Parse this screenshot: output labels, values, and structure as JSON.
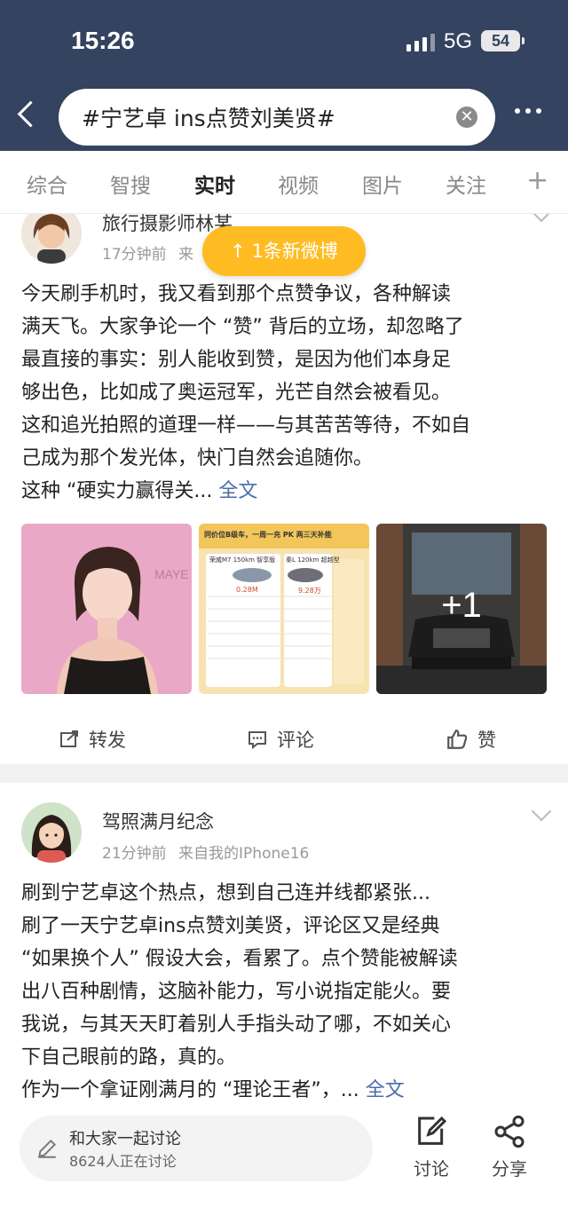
{
  "status_bar": {
    "time": "15:26",
    "network": "5G",
    "battery": "54"
  },
  "search": {
    "query": "#宁艺卓 ins点赞刘美贤#"
  },
  "tabs": [
    {
      "label": "综合",
      "active": false
    },
    {
      "label": "智搜",
      "active": false
    },
    {
      "label": "实时",
      "active": true
    },
    {
      "label": "视频",
      "active": false
    },
    {
      "label": "图片",
      "active": false
    },
    {
      "label": "关注",
      "active": false
    }
  ],
  "new_posts_banner": "↑ 1条新微博",
  "posts": [
    {
      "author": "旅行摄影师林某",
      "time": "17分钟前",
      "source": "来",
      "lines": [
        "今天刷手机时，我又看到那个点赞争议，各种解读",
        "满天飞。大家争论一个 “赞” 背后的立场，却忽略了",
        "最直接的事实：别人能收到赞，是因为他们本身足",
        "够出色，比如成了奥运冠军，光芒自然会被看见。",
        "这和追光拍照的道理一样——与其苦苦等待，不如自",
        "己成为那个发光体，快门自然会追随你。",
        "这种 “硬实力赢得关..."
      ],
      "full_text_link": "全文",
      "images": {
        "image2_header": "同价位B级车，一周一充 PK 两三天补能",
        "image2_left": "荣威M7 150km 智享版",
        "image2_left_price": "0.28M",
        "image2_right": "秦L 120km 超越型",
        "image2_right_price": "9.28万",
        "image3_overlay": "+1"
      },
      "actions": {
        "repost": "转发",
        "comment": "评论",
        "like": "赞"
      }
    },
    {
      "author": "驾照满月纪念",
      "time": "21分钟前",
      "source": "来自我的IPhone16",
      "lines": [
        "刷到宁艺卓这个热点，想到自己连并线都紧张...",
        "刷了一天宁艺卓ins点赞刘美贤，评论区又是经典",
        "“如果换个人” 假设大会，看累了。点个赞能被解读",
        "出八百种剧情，这脑补能力，写小说指定能火。要",
        "我说，与其天天盯着别人手指头动了哪，不如关心",
        "下自己眼前的路，真的。",
        "作为一个拿证刚满月的 “理论王者”，..."
      ],
      "full_text_link": "全文"
    }
  ],
  "bottom_bar": {
    "discuss_title": "和大家一起讨论",
    "discuss_count": "8624人正在讨论",
    "discuss_button": "讨论",
    "share_button": "分享"
  }
}
